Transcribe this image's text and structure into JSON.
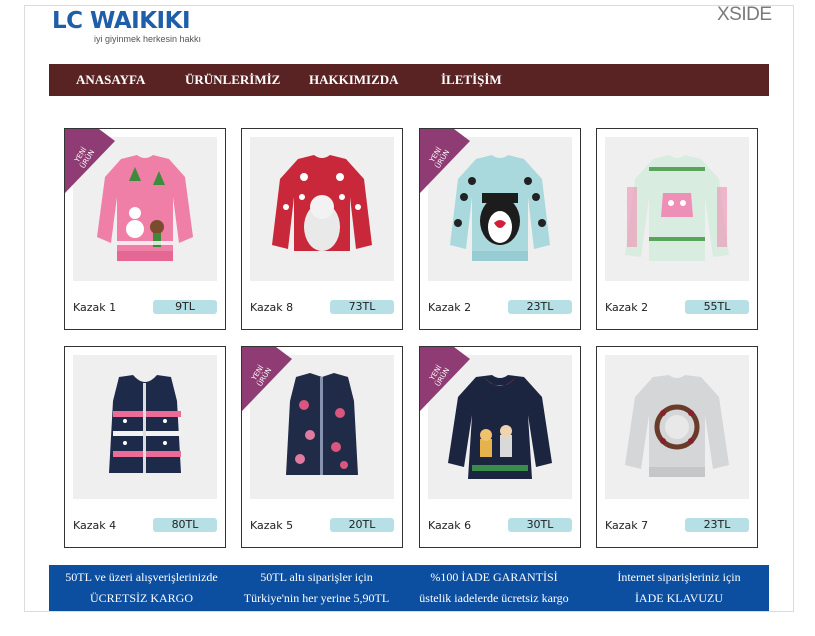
{
  "header": {
    "logo_main": "LC WAIKIKI",
    "logo_tagline": "iyi giyinmek herkesin hakkı",
    "brand_right": "XSIDE"
  },
  "nav": {
    "items": [
      "ANASAYFA",
      "ÜRÜNLERİMİZ",
      "HAKKIMIZDA",
      "İLETİŞİM"
    ],
    "bg_color": "#5a2323"
  },
  "badge": {
    "text_line1": "YENİ",
    "text_line2": "ÜRÜN",
    "color": "#8e3c73"
  },
  "products": [
    {
      "name": "Kazak 1",
      "price": "9TL",
      "is_new": true,
      "image": "pink-snowman-sweater"
    },
    {
      "name": "Kazak 8",
      "price": "73TL",
      "is_new": false,
      "image": "red-bear-sweater"
    },
    {
      "name": "Kazak 2",
      "price": "23TL",
      "is_new": true,
      "image": "penguin-polkadot-sweater"
    },
    {
      "name": "Kazak 2",
      "price": "55TL",
      "is_new": false,
      "image": "mint-owl-sweater"
    },
    {
      "name": "Kazak 4",
      "price": "80TL",
      "is_new": false,
      "image": "navy-fairisle-vest"
    },
    {
      "name": "Kazak 5",
      "price": "20TL",
      "is_new": true,
      "image": "navy-floral-vest"
    },
    {
      "name": "Kazak 6",
      "price": "30TL",
      "is_new": true,
      "image": "navy-collar-tunic"
    },
    {
      "name": "Kazak 7",
      "price": "23TL",
      "is_new": false,
      "image": "grey-wreath-sweater"
    }
  ],
  "footer": {
    "bg_color": "#0c4ea0",
    "columns": [
      {
        "line1": "50TL ve üzeri alışverişlerinizde",
        "line2": "ÜCRETSİZ KARGO"
      },
      {
        "line1": "50TL altı siparişler için",
        "line2": "Türkiye'nin her yerine 5,90TL"
      },
      {
        "line1": "%100 İADE GARANTİSİ",
        "line2": "üstelik iadelerde ücretsiz kargo"
      },
      {
        "line1": "İnternet siparişleriniz için",
        "line2": "İADE KLAVUZU"
      }
    ]
  }
}
